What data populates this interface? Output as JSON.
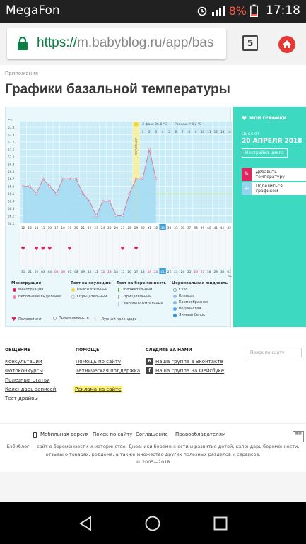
{
  "status_bar": {
    "carrier": "MegaFon",
    "battery_percent": "8%",
    "time": "17:18",
    "icons": [
      "alarm-icon",
      "signal-icon",
      "battery-icon"
    ]
  },
  "browser": {
    "url_scheme": "https://",
    "url_rest": "m.babyblog.ru/app/bas",
    "tab_count": "5"
  },
  "page": {
    "breadcrumb": "Приложения",
    "title": "Графики базальной температуры"
  },
  "chart": {
    "unit": "C°",
    "y_ticks": [
      "57.4",
      "57.3",
      "57.2",
      "57.1",
      "57.0",
      "56.9",
      "56.8",
      "56.7",
      "56.6",
      "56.5",
      "56.4",
      "56.3",
      "56.2",
      "56.1"
    ],
    "phase_label": "2 фаза 36.8 °C",
    "diff_label": "Разница t° 0.2 °C",
    "ovulation_label": "овуляция",
    "top_days": [
      "1",
      "2",
      "3",
      "4",
      "5",
      "6",
      "7",
      "8",
      "9",
      "10",
      "11",
      "12",
      "13",
      "14"
    ],
    "cycle_days": [
      "12",
      "13",
      "14",
      "15",
      "16",
      "17",
      "18",
      "19",
      "20",
      "21",
      "22",
      "23",
      "24",
      "25",
      "26",
      "27",
      "28",
      "29",
      "30",
      "31",
      "32",
      "33",
      "34",
      "35",
      "36",
      "37",
      "38",
      "39",
      "40",
      "41",
      "42",
      "43"
    ],
    "dates": [
      "31",
      "01",
      "02",
      "03",
      "04",
      "05",
      "06",
      "07",
      "08",
      "09",
      "10",
      "11",
      "12",
      "13",
      "14",
      "15",
      "16",
      "17",
      "18",
      "19",
      "20",
      "21",
      "22",
      "23",
      "24",
      "25",
      "26",
      "27",
      "28",
      "29",
      "30",
      "01"
    ],
    "month_label": "Янв"
  },
  "chart_data": {
    "type": "line",
    "title": "Графики базальной температуры",
    "xlabel": "",
    "ylabel": "C°",
    "x": [
      12,
      13,
      14,
      15,
      16,
      17,
      18,
      19,
      20,
      21,
      22,
      23,
      24,
      25,
      26,
      27,
      28,
      29,
      30,
      31,
      32
    ],
    "series": [
      {
        "values": [
          56.6,
          56.6,
          56.5,
          56.7,
          56.6,
          56.5,
          56.7,
          56.7,
          56.7,
          56.5,
          56.4,
          56.2,
          56.4,
          56.4,
          56.2,
          56.2,
          56.5,
          56.7,
          56.7,
          57.1,
          56.7
        ]
      }
    ],
    "ylim": [
      56.1,
      57.4
    ],
    "ovulation_day": 29,
    "coverline": 56.5,
    "heart_days": [
      12,
      14,
      15,
      16,
      19,
      27,
      29
    ]
  },
  "side_panel": {
    "my_charts": "МОИ ГРАФИКИ",
    "cycle_from_label": "Цикл от",
    "cycle_date": "20 АПРЕЛЯ 2018",
    "cycle_settings": "Настройка цикла",
    "add_temp": "Добавить температуру",
    "share": "Поделиться графиком",
    "accent": "#3dd9c1"
  },
  "legend": {
    "menstruation": {
      "title": "Менструация",
      "items": [
        "Менструация",
        "Небольшие выделения"
      ]
    },
    "ovulation_test": {
      "title": "Тест на овуляцию",
      "items": [
        "Положительный",
        "Отрицательный"
      ]
    },
    "pregnancy_test": {
      "title": "Тест на беременность",
      "items": [
        "Положительный",
        "Отрицательный",
        "Слабоположительный"
      ]
    },
    "cervical": {
      "title": "Цервикальная жидкость",
      "items": [
        "Сухо",
        "Клейкая",
        "Кремообразная",
        "Водянистая",
        "Яичный белок"
      ]
    },
    "bottom": [
      "Половой акт",
      "Прием лекарств",
      "Лунный календарь"
    ]
  },
  "footer": {
    "col1": {
      "title": "ОБЩЕНИЕ",
      "links": [
        "Консультации",
        "Фотоконкурсы",
        "Полезные статьи",
        "Календарь записей",
        "Тест-драйвы"
      ]
    },
    "col2": {
      "title": "ПОМОЩЬ",
      "links": [
        "Помощь по сайту",
        "Техническая поддержка"
      ],
      "highlight": "Реклама на сайте"
    },
    "col3": {
      "title": "СЛЕДИТЕ ЗА НАМИ",
      "links": [
        "Наша группа в Вконтакте",
        "Наша группа на Фейсбуке"
      ]
    },
    "search_placeholder": "Поиск по сайту",
    "bottom_links": [
      "Мобильная версия",
      "Поиск по сайту",
      "Соглашение",
      "Правообладателям"
    ],
    "about1": "Бэбиблог — сайт о беременности и материнстве. Дневники беременности и развития детей, календарь беременности,",
    "about2": "отзывы о товарах, роддома, а также множество других полезных разделов и сервисов.",
    "copyright": "© 2005—2018"
  }
}
